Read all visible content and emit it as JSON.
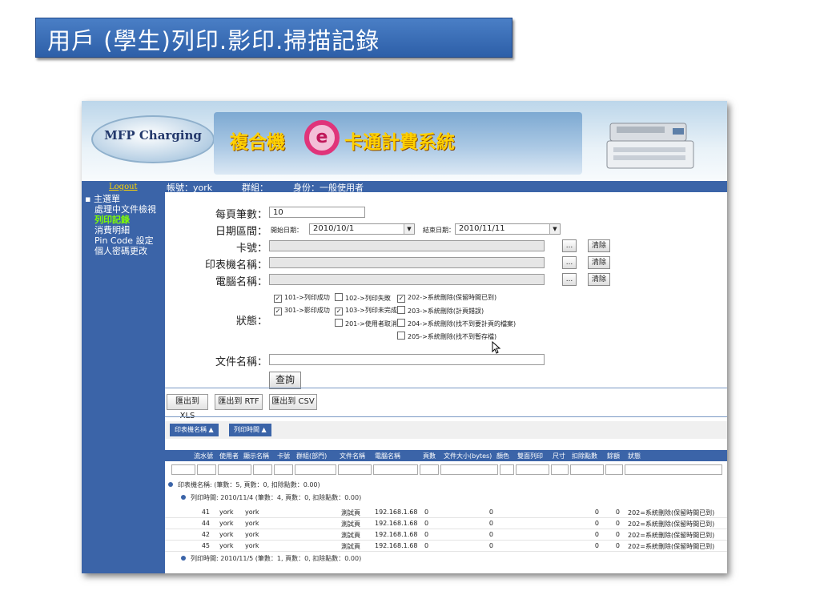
{
  "slide_title": "用戶 (學生)列印.影印.掃描記錄",
  "app": {
    "logo_text": "MFP Charging",
    "banner_part1": "複合機",
    "banner_e": "e",
    "banner_part2": "卡通計費系統"
  },
  "sidebar": {
    "logout": "Logout",
    "root": "▪ 主選單",
    "items": [
      {
        "label": "處理中文件檢視"
      },
      {
        "label": "列印記錄"
      },
      {
        "label": "消費明細"
      },
      {
        "label": "Pin Code 設定"
      },
      {
        "label": "個人密碼更改"
      }
    ]
  },
  "infobar": {
    "account": "帳號：york",
    "group": "群組：",
    "identity": "身份：一般使用者"
  },
  "form": {
    "page_size_label": "每頁筆數：",
    "page_size_value": "10",
    "date_label": "日期區間：",
    "start_label": "開始日期：",
    "start_value": "2010/10/1",
    "end_label": "結束日期：",
    "end_value": "2010/11/11",
    "card_label": "卡號：",
    "printer_label": "印表機名稱：",
    "computer_label": "電腦名稱：",
    "browse": "...",
    "clear": "清除",
    "status_label": "狀態：",
    "status_options": [
      {
        "label": "101->列印成功",
        "checked": true
      },
      {
        "label": "102->列印失敗",
        "checked": false
      },
      {
        "label": "202->系統刪除(保留時間已到)",
        "checked": true
      },
      {
        "label": "301->影印成功",
        "checked": true
      },
      {
        "label": "103->列印未完成",
        "checked": true
      },
      {
        "label": "203->系統刪除(計頁錯誤)",
        "checked": false
      },
      {
        "label": "201->使用者取消",
        "checked": false
      },
      {
        "label": "204->系統刪除(找不到要計頁的檔案)",
        "checked": false
      },
      {
        "label": "205->系統刪除(找不到暫存檔)",
        "checked": false
      }
    ],
    "docname_label": "文件名稱：",
    "query": "查詢"
  },
  "exports": [
    "匯出到 XLS",
    "匯出到 RTF",
    "匯出到 CSV"
  ],
  "grid": {
    "group_buttons": [
      "印表機名稱 ▲",
      "列印時間 ▲"
    ],
    "columns": [
      "流水號",
      "使用者",
      "顯示名稱",
      "卡號",
      "群組(部門)",
      "文件名稱",
      "電腦名稱",
      "頁數",
      "文件大小(bytes)",
      "顏色",
      "雙面列印",
      "尺寸",
      "扣除點數",
      "餘額",
      "狀態"
    ],
    "group1": "印表機名稱: (筆數：5, 頁數：0, 扣除點數：0.00)",
    "group2": "列印時間: 2010/11/4 (筆數：4, 頁數：0, 扣除點數：0.00)",
    "group3": "列印時間: 2010/11/5 (筆數：1, 頁數：0, 扣除點數：0.00)",
    "rows": [
      {
        "id": "41",
        "user": "york",
        "display": "york",
        "doc": "測試頁",
        "pc": "192.168.1.68",
        "pages": "0",
        "size": "0",
        "deduct": "0",
        "balance": "0",
        "status": "202=系統刪除(保留時間已到)"
      },
      {
        "id": "44",
        "user": "york",
        "display": "york",
        "doc": "測試頁",
        "pc": "192.168.1.68",
        "pages": "0",
        "size": "0",
        "deduct": "0",
        "balance": "0",
        "status": "202=系統刪除(保留時間已到)"
      },
      {
        "id": "42",
        "user": "york",
        "display": "york",
        "doc": "測試頁",
        "pc": "192.168.1.68",
        "pages": "0",
        "size": "0",
        "deduct": "0",
        "balance": "0",
        "status": "202=系統刪除(保留時間已到)"
      },
      {
        "id": "45",
        "user": "york",
        "display": "york",
        "doc": "測試頁",
        "pc": "192.168.1.68",
        "pages": "0",
        "size": "0",
        "deduct": "0",
        "balance": "0",
        "status": "202=系統刪除(保留時間已到)"
      }
    ]
  }
}
